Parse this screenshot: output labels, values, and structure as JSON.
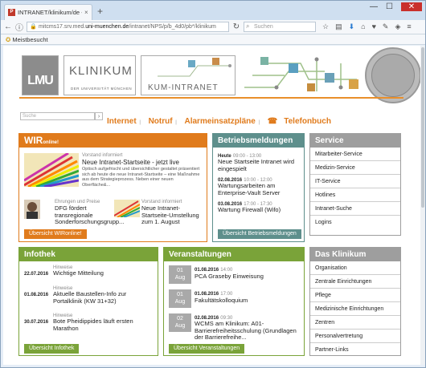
{
  "browser": {
    "tab_title": "INTRANET/klinikum/de - I...",
    "tab_close": "×",
    "new_tab": "+",
    "url_gray_prefix": "mitcms17.srv.med.",
    "url_domain": "uni-muenchen.de",
    "url_path": "/intranet/NPS/p/b_4d0/pb*/klinikum",
    "search_placeholder": "Suchen",
    "bookmark": "Meistbesucht",
    "minimize": "—",
    "maximize": "☐",
    "close": "✕"
  },
  "header": {
    "lmu": "LMU",
    "klinikum": "KLINIKUM",
    "klinikum_sub": "DER UNIVERSITÄT MÜNCHEN",
    "kum": "KUM-INTRANET",
    "search_placeholder": "Suche",
    "search_btn": "›"
  },
  "toplinks": [
    "Internet",
    "Notruf",
    "Alarmeinsatzpläne",
    "Telefonbuch"
  ],
  "wir": {
    "title": "WIR",
    "title_sup": "online!",
    "a1_cat": "Vorstand informiert",
    "a1_title": "Neue Intranet-Startseite - jetzt live",
    "a1_text": "Optisch aufgefrischt und übersichtlicher gestaltet präsentiert sich ab heute die neue Intranet-Startseite – eine Maßnahme aus dem Strategieprozess. Neben einer neuen Oberfläche&...",
    "a2_cat": "Ehrungen und Preise",
    "a2_title": "DFG fördert transregionale Sonderforschungsgrupp...",
    "a3_cat": "Vorstand informiert",
    "a3_title": "Neue Intranet-Startseite-Umstellung zum 1. August",
    "btn": "Übersicht WIRonline!"
  },
  "betrieb": {
    "title": "Betriebsmeldungen",
    "items": [
      {
        "date": "Heute",
        "time": "09:00 - 13:00",
        "text": "Neue Startseite Intranet wird eingespielt"
      },
      {
        "date": "02.08.2016",
        "time": "10:00 - 12:00",
        "text": "Wartungsarbeiten am Enterprise-Vault Server"
      },
      {
        "date": "03.08.2016",
        "time": "17:00 - 17:30",
        "text": "Wartung Firewall (Wifo)"
      }
    ],
    "btn": "Übersicht Betriebsmeldungen"
  },
  "service": {
    "title": "Service",
    "items": [
      "Mitarbeiter-Service",
      "Medizin-Service",
      "IT-Service",
      "Hotlines",
      "Intranet-Suche",
      "Logins"
    ]
  },
  "infothek": {
    "title": "Infothek",
    "items": [
      {
        "date": "22.07.2016",
        "cat": "Hinweise",
        "text": "Wichtige Mitteilung"
      },
      {
        "date": "01.08.2016",
        "cat": "Hinweise",
        "text": "Aktuelle Baustellen-Info zur Portalklinik (KW 31+32)"
      },
      {
        "date": "30.07.2016",
        "cat": "Hinweise",
        "text": "Bote Pheidippides läuft ersten Marathon"
      }
    ],
    "btn": "Übersicht Infothek"
  },
  "events": {
    "title": "Veranstaltungen",
    "items": [
      {
        "day": "01",
        "mon": "Aug",
        "date": "01.08.2016",
        "time": "14:00",
        "text": "PCA Graseby Einweisung"
      },
      {
        "day": "01",
        "mon": "Aug",
        "date": "01.08.2016",
        "time": "17:00",
        "text": "Fakultätskolloquium"
      },
      {
        "day": "02",
        "mon": "Aug",
        "date": "02.08.2016",
        "time": "09:30",
        "text": "WCMS am Klinikum: A01-Barrierefreiheitsschulung (Grundlagen der Barrierefreihe..."
      }
    ],
    "btn": "Übersicht Veranstaltungen"
  },
  "klinikum": {
    "title": "Das Klinikum",
    "items": [
      "Organisation",
      "Zentrale Einrichtungen",
      "Pflege",
      "Medizinische Einrichtungen",
      "Zentren",
      "Personalvertretung",
      "Partner-Links"
    ]
  },
  "colors": {
    "orange": "#e07b1c",
    "teal": "#5e8f8c",
    "gray": "#9e9e9e",
    "green": "#7aa339"
  }
}
